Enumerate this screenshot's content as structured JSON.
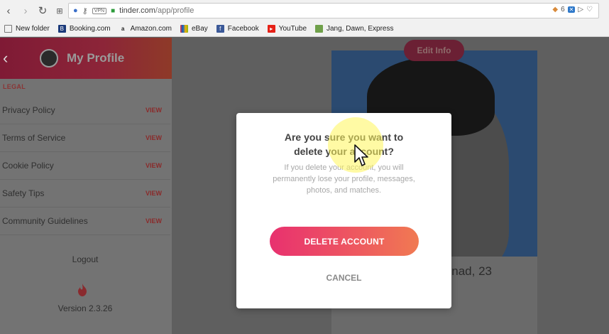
{
  "browser": {
    "url_host": "tinder.com",
    "url_path": "/app/profile",
    "vpn_label": "VPN",
    "ext_count": "6",
    "bookmarks": [
      {
        "label": "New folder",
        "icon": "folder-icon",
        "color": "#777777"
      },
      {
        "label": "Booking.com",
        "icon": "booking-icon",
        "color": "#1b3a7a"
      },
      {
        "label": "Amazon.com",
        "icon": "amazon-icon",
        "color": "#222222"
      },
      {
        "label": "eBay",
        "icon": "ebay-icon",
        "color": "#e53238"
      },
      {
        "label": "Facebook",
        "icon": "facebook-icon",
        "color": "#3b5998"
      },
      {
        "label": "YouTube",
        "icon": "youtube-icon",
        "color": "#e62117"
      },
      {
        "label": "Jang, Dawn, Express",
        "icon": "news-icon",
        "color": "#6fa04a"
      }
    ]
  },
  "sidebar": {
    "title": "My Profile",
    "section": "LEGAL",
    "items": [
      {
        "label": "Privacy Policy",
        "action": "VIEW"
      },
      {
        "label": "Terms of Service",
        "action": "VIEW"
      },
      {
        "label": "Cookie Policy",
        "action": "VIEW"
      },
      {
        "label": "Safety Tips",
        "action": "VIEW"
      },
      {
        "label": "Community Guidelines",
        "action": "VIEW"
      }
    ],
    "logout": "Logout",
    "version": "Version 2.3.26"
  },
  "profile": {
    "edit_info": "Edit Info",
    "name_visible": "nad, 23"
  },
  "modal": {
    "title": "Are you sure you want to delete your account?",
    "message": "If you delete your account, you will permanently lose your profile, messages, photos, and matches.",
    "delete_label": "DELETE ACCOUNT",
    "cancel_label": "CANCEL"
  },
  "colors": {
    "brand_start": "#e8316f",
    "brand_end": "#f07a52"
  }
}
